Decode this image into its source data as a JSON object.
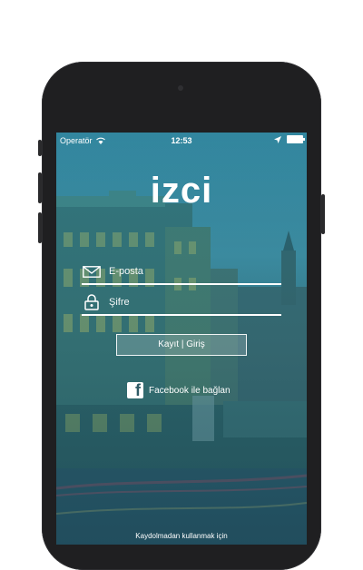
{
  "status_bar": {
    "carrier": "Operatör",
    "time": "12:53"
  },
  "logo": {
    "text": "izci"
  },
  "form": {
    "email_placeholder": "E-posta",
    "password_placeholder": "Şifre",
    "login_label": "Kayıt | Giriş",
    "facebook_label": "Facebook ile bağlan"
  },
  "footer": {
    "skip_label": "Kaydolmadan kullanmak için"
  },
  "colors": {
    "phone_body": "#1f1f21",
    "screen_tint": "#3f8ea6",
    "text": "#ffffff"
  },
  "icons": {
    "wifi": "wifi-icon",
    "location": "location-arrow-icon",
    "battery": "battery-icon",
    "email": "envelope-icon",
    "password": "lock-icon",
    "facebook": "facebook-icon"
  }
}
